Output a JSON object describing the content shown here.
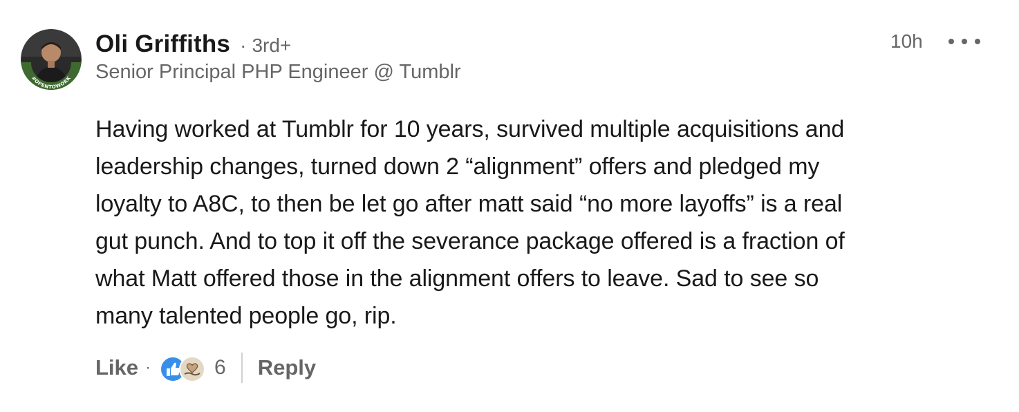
{
  "comment": {
    "author": {
      "name": "Oli Griffiths",
      "degree": "3rd+",
      "headline": "Senior Principal PHP Engineer @ Tumblr",
      "avatar_badge": "#OPENTOWORK",
      "avatar_badge_color": "#3f6e2f"
    },
    "timestamp": "10h",
    "more_icon": "ellipsis-icon",
    "body_lines": [
      "Having worked at Tumblr for 10 years, survived multiple acquisitions and",
      "leadership changes, turned down 2 “alignment” offers and pledged my",
      "loyalty to A8C, to then be let go after matt said “no more layoffs” is a real",
      "gut punch. And to top it off the severance package offered is a fraction of",
      "what Matt offered those in the alignment offers to leave. Sad to see so",
      "many talented people go, rip."
    ],
    "actions": {
      "like_label": "Like",
      "separator": "·",
      "reactions": [
        "like-reaction-icon",
        "support-reaction-icon"
      ],
      "reaction_count": "6",
      "reply_label": "Reply"
    }
  },
  "colors": {
    "text_primary": "#000000e6",
    "text_secondary": "#666666",
    "like_blue": "#378fe9",
    "support_tan": "#c9b99c"
  }
}
